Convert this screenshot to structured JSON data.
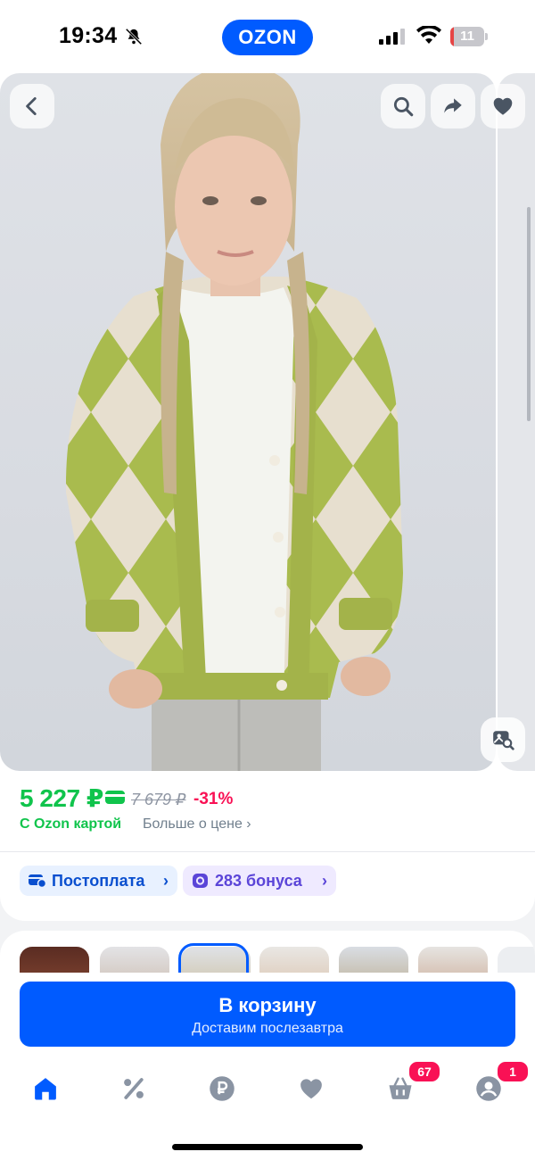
{
  "status_bar": {
    "time": "19:34",
    "logo": "OZON",
    "battery": "11",
    "battery_level": 0.11
  },
  "gallery": {
    "back_icon": "chevron-left-icon",
    "actions": [
      "search-icon",
      "share-icon",
      "heart-icon"
    ],
    "similar_icon": "image-search-icon"
  },
  "price": {
    "current": "5 227 ₽",
    "old": "7 679 ₽",
    "discount": "-31%",
    "with_card": "С Ozon картой",
    "more": "Больше о цене ›"
  },
  "chips": {
    "postpay": "Постоплата",
    "bonus": "283 бонуса",
    "chevron": "›"
  },
  "cart": {
    "title": "В корзину",
    "subtitle": "Доставим послезавтра"
  },
  "nav": {
    "items": [
      "home-icon",
      "percent-icon",
      "ruble-icon",
      "heart-icon",
      "cart-icon",
      "profile-icon"
    ],
    "cart_badge": "67",
    "profile_badge": "1"
  },
  "colors": {
    "brand": "#005bff",
    "price_green": "#10c44c",
    "discount_red": "#f91155",
    "badge": "#f91155"
  }
}
